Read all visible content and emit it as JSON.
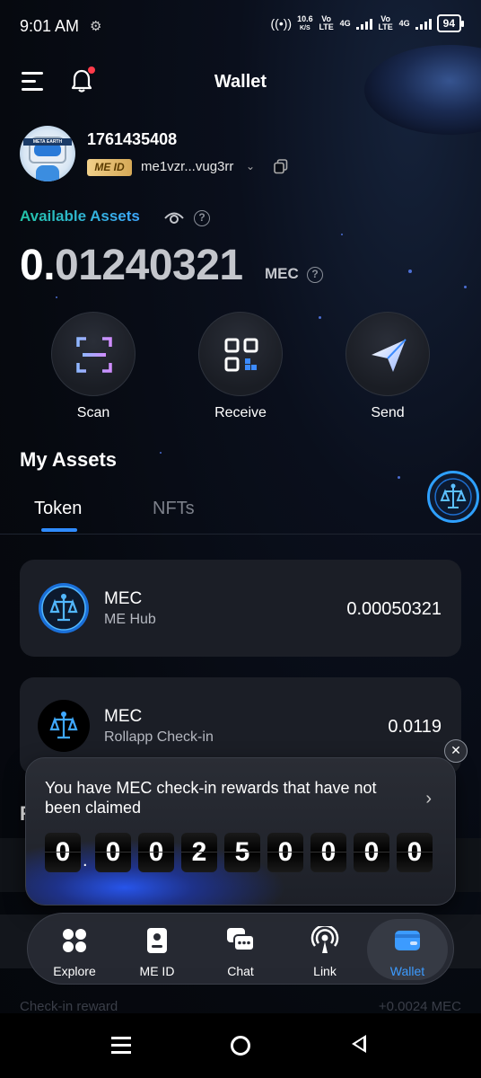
{
  "status_bar": {
    "time": "9:01 AM",
    "net_speed": "10.6",
    "net_unit": "K/S",
    "vo_lte_1": "Vo LTE",
    "net_4g_1": "4G",
    "vo_lte_2": "Vo LTE",
    "net_4g_2": "4G",
    "battery": "94"
  },
  "header": {
    "title": "Wallet",
    "menu_icon": "hamburger-menu-icon",
    "bell_icon": "bell-icon",
    "notification_dot": true
  },
  "profile": {
    "user_id": "1761435408",
    "badge": "ME ID",
    "address": "me1vzr...vug3rr",
    "avatar_text": "META EARTH"
  },
  "balance": {
    "label": "Available Assets",
    "value_int": "0.",
    "value_dec": "01240321",
    "unit": "MEC",
    "help_glyph": "?"
  },
  "actions": [
    {
      "label": "Scan",
      "icon": "scan-icon"
    },
    {
      "label": "Receive",
      "icon": "qr-code-icon"
    },
    {
      "label": "Send",
      "icon": "paper-plane-icon"
    }
  ],
  "my_assets": {
    "title": "My Assets",
    "tabs": [
      {
        "label": "Token",
        "active": true
      },
      {
        "label": "NFTs",
        "active": false
      }
    ]
  },
  "assets": [
    {
      "name": "MEC",
      "sub": "ME Hub",
      "amount": "0.00050321"
    },
    {
      "name": "MEC",
      "sub": "Rollapp Check-in",
      "amount": "0.0119"
    }
  ],
  "peek": {
    "section_letter": "R",
    "bottom_left": "Check-in reward",
    "bottom_right": "+0.0024 MEC"
  },
  "popup": {
    "message": "You have MEC check-in rewards that have not been claimed",
    "arrow": "›",
    "close": "✕",
    "digits": [
      "0",
      ".",
      "0",
      "0",
      "2",
      "5",
      "0",
      "0",
      "0",
      "0"
    ]
  },
  "bottom_nav": [
    {
      "label": "Explore",
      "icon": "explore-icon",
      "active": false
    },
    {
      "label": "ME ID",
      "icon": "id-card-icon",
      "active": false
    },
    {
      "label": "Chat",
      "icon": "chat-icon",
      "active": false
    },
    {
      "label": "Link",
      "icon": "broadcast-icon",
      "active": false
    },
    {
      "label": "Wallet",
      "icon": "wallet-icon",
      "active": true
    }
  ],
  "colors": {
    "accent": "#2f8bff",
    "available_label": "#3ec6ff",
    "card_bg": "#1b1e26",
    "notification": "#ff3b4a"
  }
}
